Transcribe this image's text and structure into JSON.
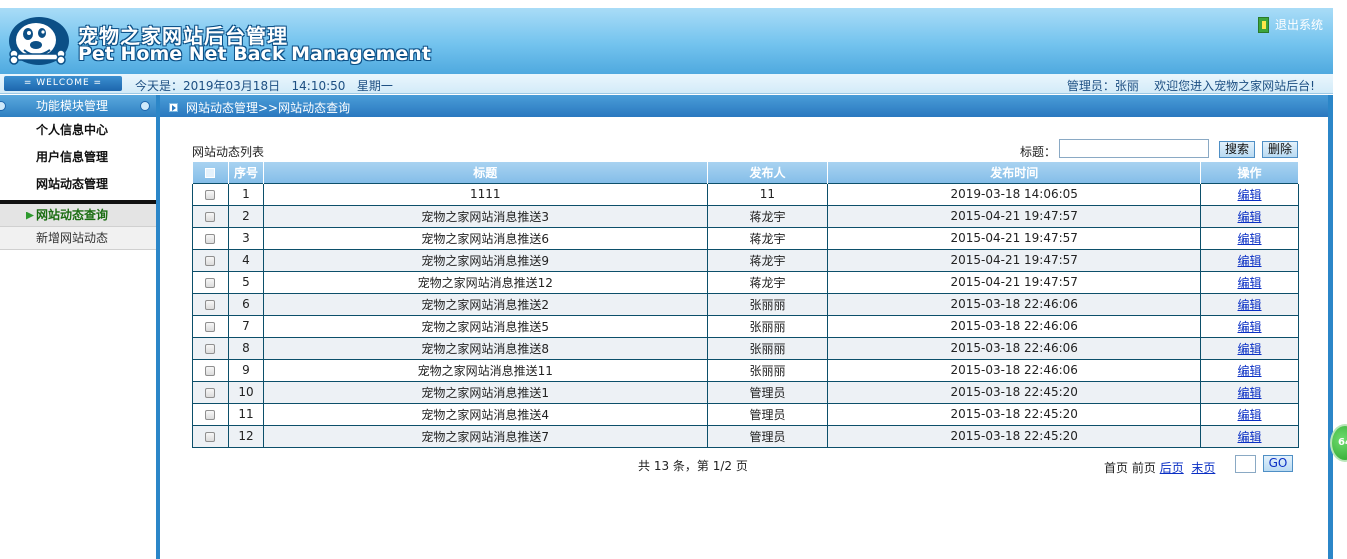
{
  "header": {
    "title": "宠物之家网站后台管理",
    "subtitle": "Pet Home Net Back Management",
    "logout_label": "退出系统"
  },
  "welcome_bar": {
    "badge": "= WELCOME =",
    "today": "今天是：2019年03月18日   14:10:50   星期一",
    "admin_greeting": "管理员：张丽    欢迎您进入宠物之家网站后台!"
  },
  "sidebar": {
    "head": "功能模块管理",
    "items": [
      "个人信息中心",
      "用户信息管理",
      "网站动态管理"
    ],
    "sub_items": [
      {
        "label": "网站动态查询",
        "active": true
      },
      {
        "label": "新增网站动态",
        "active": false
      }
    ]
  },
  "breadcrumb": "网站动态管理>>网站动态查询",
  "list": {
    "title": "网站动态列表",
    "filter_label": "标题：",
    "filter_value": "",
    "search_label": "搜索",
    "delete_label": "删除",
    "columns": [
      "",
      "序号",
      "标题",
      "发布人",
      "发布时间",
      "操作"
    ],
    "rows": [
      {
        "no": "1",
        "title": "1111",
        "publisher": "11",
        "time": "2019-03-18 14:06:05",
        "action": "编辑"
      },
      {
        "no": "2",
        "title": "宠物之家网站消息推送3",
        "publisher": "蒋龙宇",
        "time": "2015-04-21 19:47:57",
        "action": "编辑"
      },
      {
        "no": "3",
        "title": "宠物之家网站消息推送6",
        "publisher": "蒋龙宇",
        "time": "2015-04-21 19:47:57",
        "action": "编辑"
      },
      {
        "no": "4",
        "title": "宠物之家网站消息推送9",
        "publisher": "蒋龙宇",
        "time": "2015-04-21 19:47:57",
        "action": "编辑"
      },
      {
        "no": "5",
        "title": "宠物之家网站消息推送12",
        "publisher": "蒋龙宇",
        "time": "2015-04-21 19:47:57",
        "action": "编辑"
      },
      {
        "no": "6",
        "title": "宠物之家网站消息推送2",
        "publisher": "张丽丽",
        "time": "2015-03-18 22:46:06",
        "action": "编辑"
      },
      {
        "no": "7",
        "title": "宠物之家网站消息推送5",
        "publisher": "张丽丽",
        "time": "2015-03-18 22:46:06",
        "action": "编辑"
      },
      {
        "no": "8",
        "title": "宠物之家网站消息推送8",
        "publisher": "张丽丽",
        "time": "2015-03-18 22:46:06",
        "action": "编辑"
      },
      {
        "no": "9",
        "title": "宠物之家网站消息推送11",
        "publisher": "张丽丽",
        "time": "2015-03-18 22:46:06",
        "action": "编辑"
      },
      {
        "no": "10",
        "title": "宠物之家网站消息推送1",
        "publisher": "管理员",
        "time": "2015-03-18 22:45:20",
        "action": "编辑"
      },
      {
        "no": "11",
        "title": "宠物之家网站消息推送4",
        "publisher": "管理员",
        "time": "2015-03-18 22:45:20",
        "action": "编辑"
      },
      {
        "no": "12",
        "title": "宠物之家网站消息推送7",
        "publisher": "管理员",
        "time": "2015-03-18 22:45:20",
        "action": "编辑"
      }
    ]
  },
  "pagination": {
    "summary": "共 13 条，第 1/2 页",
    "first": "首页",
    "prev": "前页",
    "next": "后页",
    "last": "末页",
    "page_input": "",
    "go_label": "GO"
  },
  "float_badge": "64",
  "colors": {
    "brand_blue": "#2b86c8",
    "header_gradient_top": "#a9dcf7",
    "link_blue": "#0a2fc4",
    "table_border": "#0c4f6a"
  }
}
